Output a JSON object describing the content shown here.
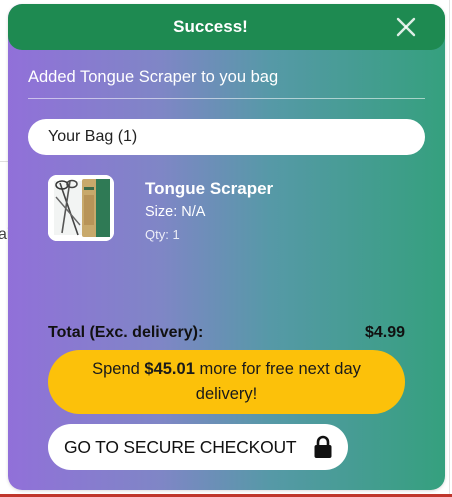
{
  "background": {
    "partial_text": "ai"
  },
  "modal": {
    "title": "Success!",
    "close_icon": "close-x-icon",
    "added_message": "Added Tongue Scraper to you bag",
    "bag_label": "Your Bag (1)",
    "product": {
      "name": "Tongue Scraper",
      "size": "Size: N/A",
      "qty": "Qty: 1",
      "image_icon": "tongue-scraper-product-image"
    },
    "total_label": "Total (Exc. delivery):",
    "total_value": "$4.99",
    "spend": {
      "prefix": "Spend ",
      "amount": "$45.01",
      "suffix": " more for free next day delivery!"
    },
    "checkout_label": "GO TO SECURE CHECKOUT",
    "checkout_icon": "lock-icon"
  },
  "colors": {
    "header": "#1e8a51",
    "gradient_start": "#9170d9",
    "gradient_end": "#35a07e",
    "spend_pill": "#fcc10a"
  }
}
